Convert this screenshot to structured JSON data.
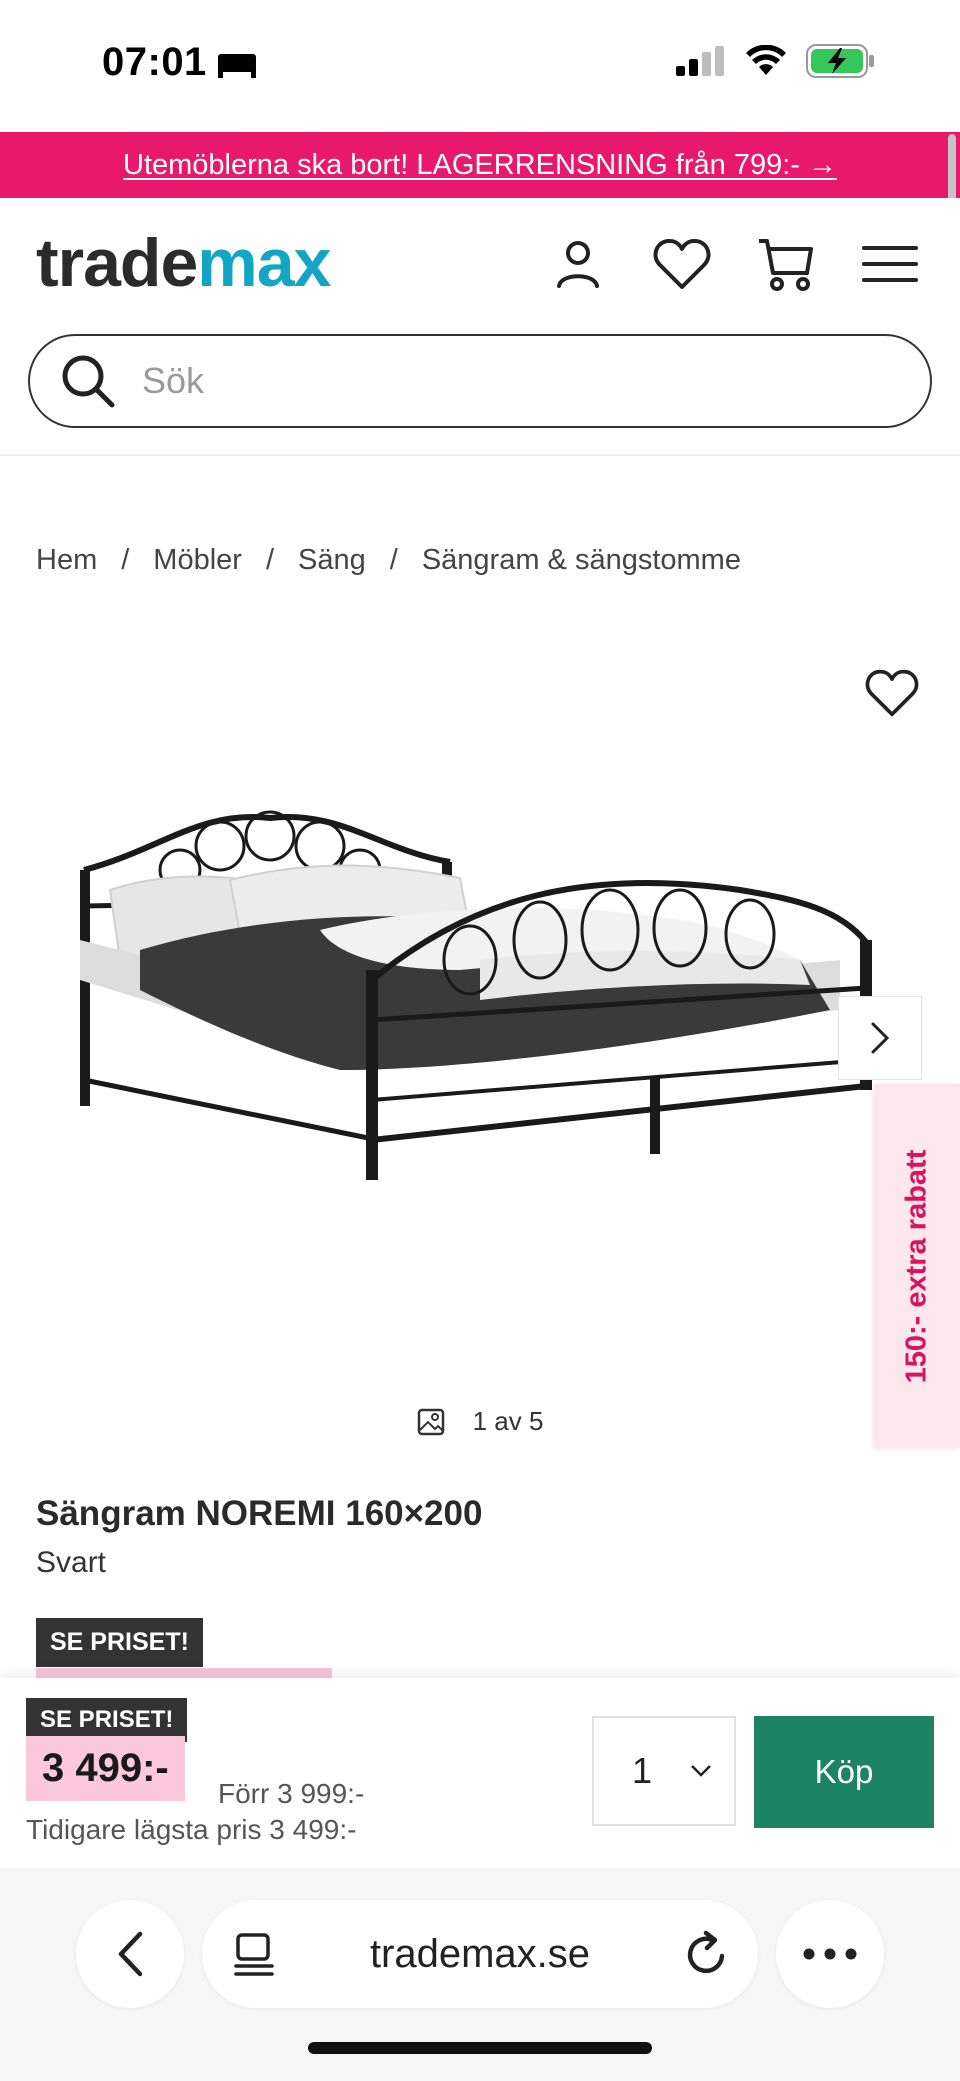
{
  "status_bar": {
    "time": "07:01"
  },
  "promo": {
    "text": "Utemöblerna ska bort! LAGERRENSNING från 799:- →"
  },
  "header": {
    "logo_part1": "trade",
    "logo_part2": "max",
    "icons": [
      "user-icon",
      "heart-icon",
      "cart-icon",
      "menu-icon"
    ],
    "search_placeholder": "Sök"
  },
  "breadcrumb": {
    "items": [
      "Hem",
      "Möbler",
      "Säng",
      "Sängram & sängstomme"
    ],
    "separator": "/"
  },
  "gallery": {
    "counter": "1 av 5"
  },
  "rabatt_tab": {
    "label": "150:- extra rabatt"
  },
  "product": {
    "title": "Sängram NOREMI 160×200",
    "color": "Svart",
    "badge": "SE PRISET!"
  },
  "sticky": {
    "badge": "SE PRISET!",
    "price": "3 499:-",
    "old_price": "Förr 3 999:-",
    "lowest_price": "Tidigare lägsta pris 3 499:-",
    "quantity": "1",
    "buy_label": "Köp"
  },
  "browser": {
    "url": "trademax.se"
  },
  "colors": {
    "brand_pink": "#e8186c",
    "brand_teal": "#12a5c4",
    "buy_green": "#1d8463",
    "price_bg": "#fbc9db"
  }
}
